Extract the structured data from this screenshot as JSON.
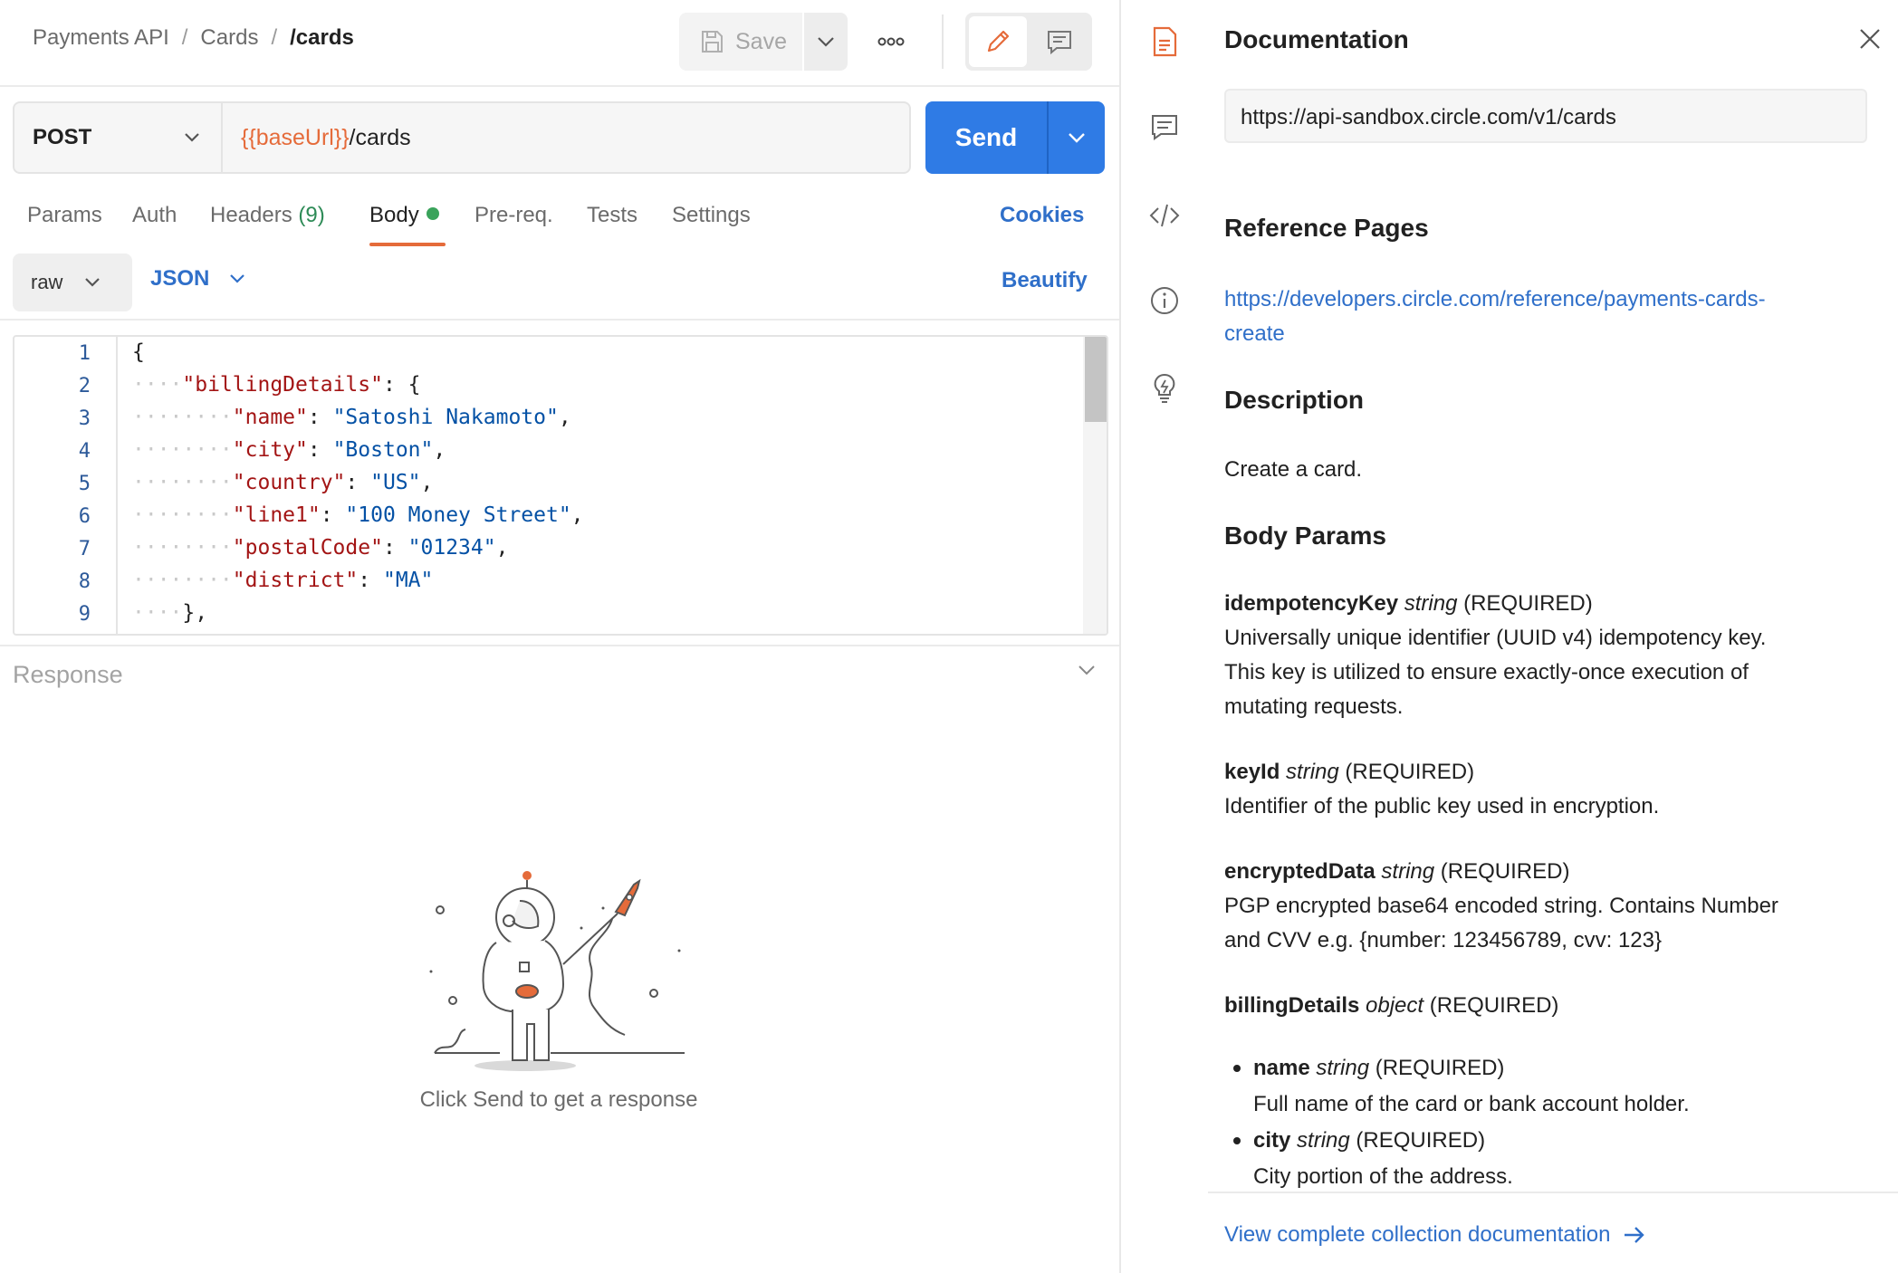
{
  "breadcrumb": {
    "items": [
      "Payments API",
      "Cards"
    ],
    "current": "/cards",
    "separator": "/"
  },
  "toolbar": {
    "save_label": "Save",
    "more_label": "ooo"
  },
  "request": {
    "method": "POST",
    "url_variable": "{{baseUrl}}",
    "url_path": "/cards",
    "send_label": "Send"
  },
  "tabs": {
    "params": "Params",
    "auth": "Auth",
    "headers": "Headers",
    "headers_count": "(9)",
    "body": "Body",
    "prereq": "Pre-req.",
    "tests": "Tests",
    "settings": "Settings",
    "cookies": "Cookies",
    "active": "Body"
  },
  "body_options": {
    "mode": "raw",
    "format": "JSON",
    "beautify": "Beautify"
  },
  "editor": {
    "line_numbers": [
      "1",
      "2",
      "3",
      "4",
      "5",
      "6",
      "7",
      "8",
      "9"
    ],
    "lines": [
      {
        "indent": "",
        "key": "",
        "sep": "",
        "value": "",
        "tail": "{"
      },
      {
        "indent": "····",
        "key": "\"billingDetails\"",
        "sep": ": ",
        "value": "",
        "tail": "{"
      },
      {
        "indent": "········",
        "key": "\"name\"",
        "sep": ": ",
        "value": "\"Satoshi Nakamoto\"",
        "tail": ","
      },
      {
        "indent": "········",
        "key": "\"city\"",
        "sep": ": ",
        "value": "\"Boston\"",
        "tail": ","
      },
      {
        "indent": "········",
        "key": "\"country\"",
        "sep": ": ",
        "value": "\"US\"",
        "tail": ","
      },
      {
        "indent": "········",
        "key": "\"line1\"",
        "sep": ": ",
        "value": "\"100 Money Street\"",
        "tail": ","
      },
      {
        "indent": "········",
        "key": "\"postalCode\"",
        "sep": ": ",
        "value": "\"01234\"",
        "tail": ","
      },
      {
        "indent": "········",
        "key": "\"district\"",
        "sep": ": ",
        "value": "\"MA\"",
        "tail": ""
      },
      {
        "indent": "····",
        "key": "",
        "sep": "",
        "value": "",
        "tail": "},"
      }
    ]
  },
  "response": {
    "title": "Response",
    "empty_message": "Click Send to get a response"
  },
  "docs": {
    "title": "Documentation",
    "url": "https://api-sandbox.circle.com/v1/cards",
    "reference_heading": "Reference Pages",
    "reference_link_line1": "https://developers.circle.com/reference/payments-cards-",
    "reference_link_line2": "create",
    "description_heading": "Description",
    "description_text": "Create a card.",
    "body_params_heading": "Body Params",
    "params": [
      {
        "name": "idempotencyKey",
        "type": "string",
        "req": "(REQUIRED)",
        "desc": [
          "Universally unique identifier (UUID v4) idempotency key.",
          "This key is utilized to ensure exactly-once execution of",
          "mutating requests."
        ]
      },
      {
        "name": "keyId",
        "type": "string",
        "req": "(REQUIRED)",
        "desc": [
          "Identifier of the public key used in encryption."
        ]
      },
      {
        "name": "encryptedData",
        "type": "string",
        "req": "(REQUIRED)",
        "desc": [
          "PGP encrypted base64 encoded string. Contains Number",
          "and CVV e.g. {number: 123456789, cvv: 123}"
        ]
      },
      {
        "name": "billingDetails",
        "type": "object",
        "req": "(REQUIRED)",
        "desc": []
      }
    ],
    "sub_params": [
      {
        "name": "name",
        "type": "string",
        "req": "(REQUIRED)",
        "desc": "Full name of the card or bank account holder."
      },
      {
        "name": "city",
        "type": "string",
        "req": "(REQUIRED)",
        "desc": "City portion of the address."
      }
    ],
    "footer_link": "View complete collection documentation"
  },
  "colors": {
    "accent": "#2f7be5",
    "link": "#2f6fc9",
    "variable": "#e56b3a",
    "json_key": "#a31515",
    "json_string": "#0451a5",
    "active_tab": "#e56b3a",
    "status_dot": "#3aa35b"
  }
}
